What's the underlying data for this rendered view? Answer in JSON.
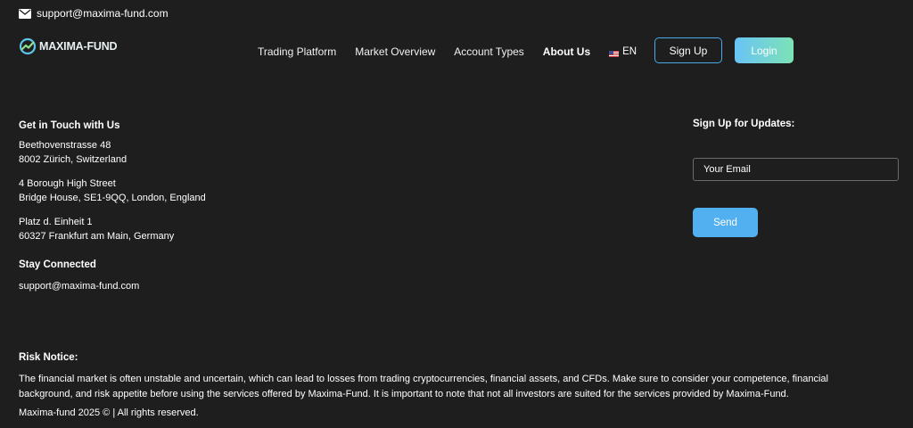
{
  "topbar": {
    "email": "support@maxima-fund.com",
    "icon": "mail-icon"
  },
  "logo": {
    "text": "MAXIMA-FUND",
    "icon": "maxima-logo-icon"
  },
  "nav": {
    "items": [
      {
        "label": "Trading Platform"
      },
      {
        "label": "Market Overview"
      },
      {
        "label": "Account Types"
      },
      {
        "label": "About Us",
        "active": true
      }
    ],
    "language": {
      "label": "EN",
      "icon": "us-flag-icon"
    }
  },
  "auth": {
    "signup_label": "Sign Up",
    "login_label": "Login"
  },
  "contact": {
    "heading": "Get in Touch with Us",
    "addresses": [
      {
        "line1": "Beethovenstrasse 48",
        "line2": "8002 Zürich, Switzerland"
      },
      {
        "line1": "4 Borough High Street",
        "line2": "Bridge House, SE1-9QQ, London, England"
      },
      {
        "line1": "Platz d. Einheit 1",
        "line2": "60327 Frankfurt am Main, Germany"
      }
    ],
    "stay_heading": "Stay Connected",
    "stay_email": "support@maxima-fund.com"
  },
  "updates": {
    "heading": "Sign Up for Updates:",
    "email_placeholder": "Your Email",
    "send_label": "Send"
  },
  "risk": {
    "heading": "Risk Notice:",
    "text": "The financial market is often unstable and uncertain, which can lead to losses from trading cryptocurrencies, financial assets, and CFDs. Make sure to consider your competence, financial background, and risk appetite before using the services offered by Maxima-Fund. It is important to note that not all investors are suited for the services provided by Maxima-Fund.",
    "copyright": "Maxima-fund 2025 © | All rights reserved."
  },
  "colors": {
    "background": "#1e1e1f",
    "accent_blue": "#52b0f0",
    "login_gradient_start": "#69c3f5",
    "login_gradient_end": "#7ce3b6"
  }
}
